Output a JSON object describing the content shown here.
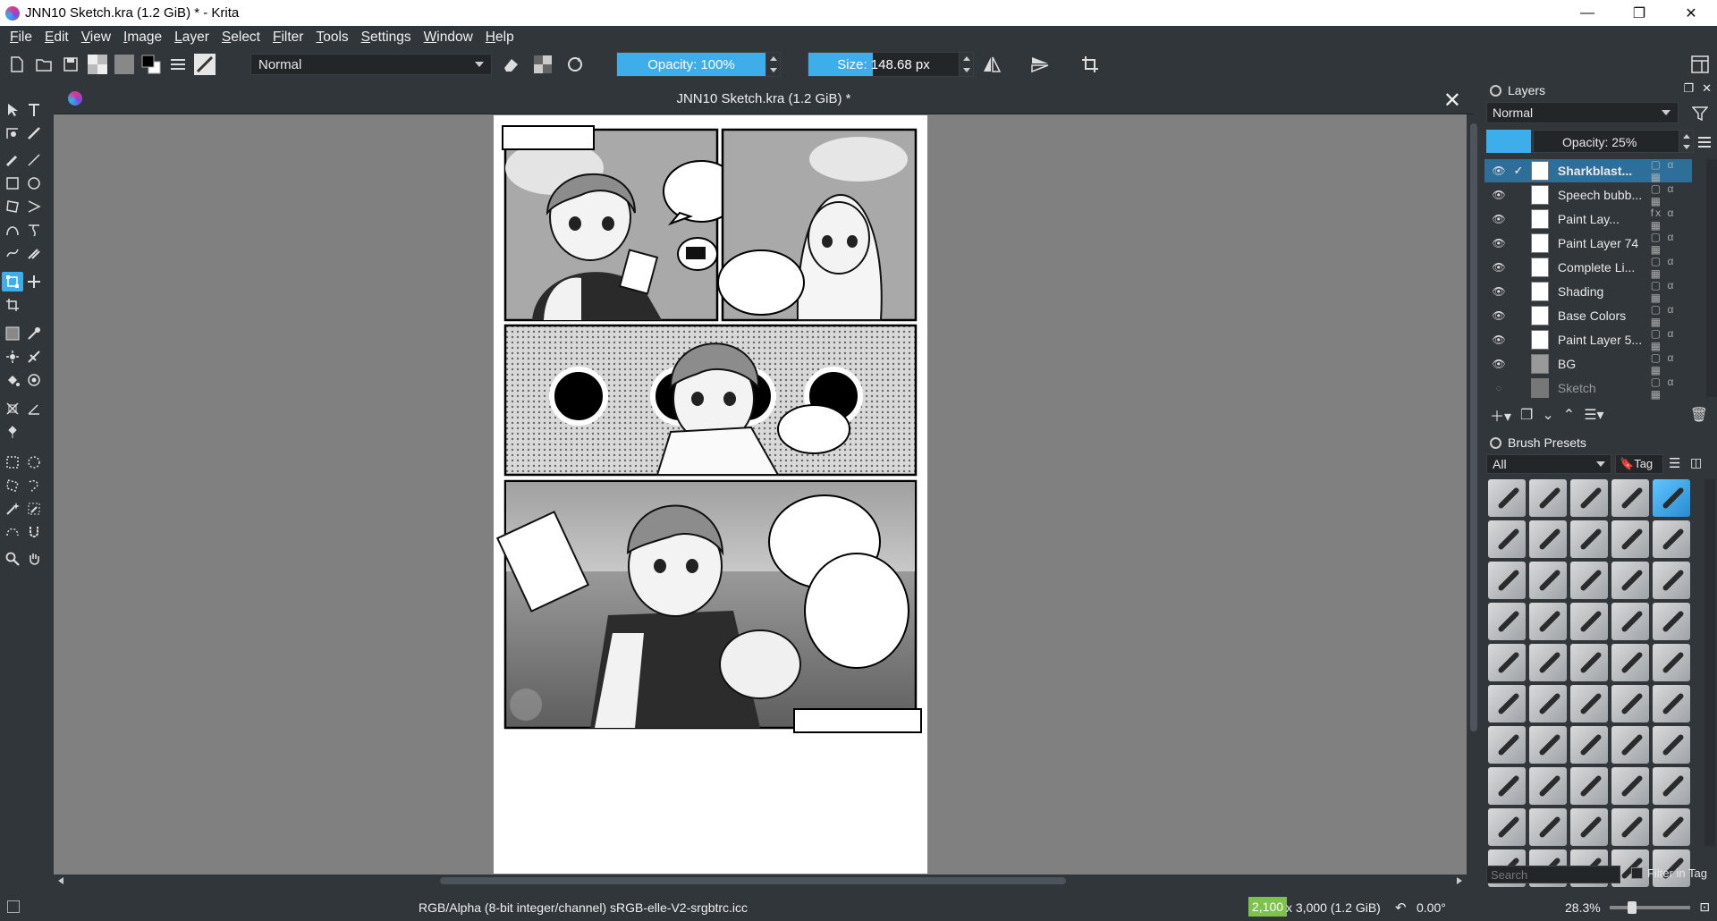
{
  "window": {
    "title": "JNN10 Sketch.kra (1.2 GiB) * - Krita",
    "minimize": "—",
    "maximize": "❐",
    "close": "✕"
  },
  "menu": [
    "File",
    "Edit",
    "View",
    "Image",
    "Layer",
    "Select",
    "Filter",
    "Tools",
    "Settings",
    "Window",
    "Help"
  ],
  "toolbar": {
    "blend_mode": "Normal",
    "opacity_label": "Opacity: 100%",
    "opacity_fraction": 1.0,
    "size_label": "Size: 148.68 px",
    "size_fraction": 0.39
  },
  "document": {
    "tab_title": "JNN10 Sketch.kra (1.2 GiB) *",
    "close": "✕"
  },
  "layers": {
    "title": "Layers",
    "blend_mode": "Normal",
    "opacity_label": "Opacity:  25%",
    "items": [
      {
        "name": "Sharkblast...",
        "selected": true,
        "visible": true
      },
      {
        "name": "Speech bubb...",
        "selected": false,
        "visible": true
      },
      {
        "name": "Paint Lay...",
        "selected": false,
        "visible": true
      },
      {
        "name": "Paint Layer 74",
        "selected": false,
        "visible": true
      },
      {
        "name": "Complete Li...",
        "selected": false,
        "visible": true
      },
      {
        "name": "Shading",
        "selected": false,
        "visible": true
      },
      {
        "name": "Base Colors",
        "selected": false,
        "visible": true
      },
      {
        "name": "Paint Layer 5...",
        "selected": false,
        "visible": true
      },
      {
        "name": "BG",
        "selected": false,
        "visible": true
      },
      {
        "name": "Sketch",
        "selected": false,
        "visible": false
      }
    ]
  },
  "brushes": {
    "title": "Brush Presets",
    "filter": "All",
    "tag_label": "Tag",
    "search_placeholder": "Search",
    "filter_in_tag": "Filter in Tag"
  },
  "status": {
    "color_profile": "RGB/Alpha (8-bit integer/channel)  sRGB-elle-V2-srgbtrc.icc",
    "dimension_highlight": "2,100",
    "dimensions": " x 3,000 (1.2 GiB)",
    "rotation": "0.00°",
    "zoom": "28.3%"
  },
  "colors": {
    "accent": "#3daee9",
    "panel_bg": "#31363b",
    "canvas_bg": "#808080"
  }
}
